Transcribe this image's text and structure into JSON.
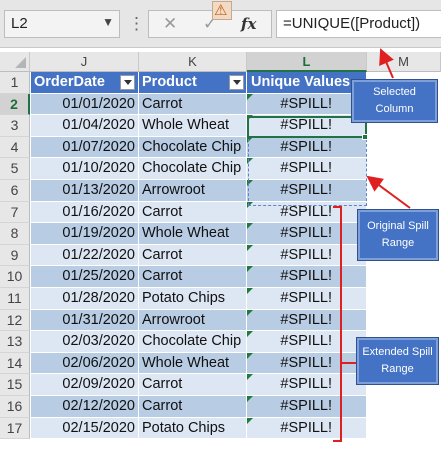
{
  "formula_bar": {
    "name_box": "L2",
    "cancel_icon": "cancel-x-icon",
    "enter_icon": "checkmark-icon",
    "function_icon": "fx",
    "formula": "=UNIQUE([Product])"
  },
  "columns": [
    "J",
    "K",
    "L",
    "M"
  ],
  "selected_column": "L",
  "table_header": {
    "row": "1",
    "order_date": "OrderDate",
    "product": "Product",
    "unique_values": "Unique Values"
  },
  "rows": [
    {
      "row": "2",
      "date": "01/01/2020",
      "product": "Carrot",
      "unique": "#SPILL!"
    },
    {
      "row": "3",
      "date": "01/04/2020",
      "product": "Whole Wheat",
      "unique": "#SPILL!"
    },
    {
      "row": "4",
      "date": "01/07/2020",
      "product": "Chocolate Chip",
      "unique": "#SPILL!"
    },
    {
      "row": "5",
      "date": "01/10/2020",
      "product": "Chocolate Chip",
      "unique": "#SPILL!"
    },
    {
      "row": "6",
      "date": "01/13/2020",
      "product": "Arrowroot",
      "unique": "#SPILL!"
    },
    {
      "row": "7",
      "date": "01/16/2020",
      "product": "Carrot",
      "unique": "#SPILL!"
    },
    {
      "row": "8",
      "date": "01/19/2020",
      "product": "Whole Wheat",
      "unique": "#SPILL!"
    },
    {
      "row": "9",
      "date": "01/22/2020",
      "product": "Carrot",
      "unique": "#SPILL!"
    },
    {
      "row": "10",
      "date": "01/25/2020",
      "product": "Carrot",
      "unique": "#SPILL!"
    },
    {
      "row": "11",
      "date": "01/28/2020",
      "product": "Potato Chips",
      "unique": "#SPILL!"
    },
    {
      "row": "12",
      "date": "01/31/2020",
      "product": "Arrowroot",
      "unique": "#SPILL!"
    },
    {
      "row": "13",
      "date": "02/03/2020",
      "product": "Chocolate Chip",
      "unique": "#SPILL!"
    },
    {
      "row": "14",
      "date": "02/06/2020",
      "product": "Whole Wheat",
      "unique": "#SPILL!"
    },
    {
      "row": "15",
      "date": "02/09/2020",
      "product": "Carrot",
      "unique": "#SPILL!"
    },
    {
      "row": "16",
      "date": "02/12/2020",
      "product": "Carrot",
      "unique": "#SPILL!"
    },
    {
      "row": "17",
      "date": "02/15/2020",
      "product": "Potato Chips",
      "unique": "#SPILL!"
    }
  ],
  "callouts": {
    "selected_column": "Selected Column",
    "original_spill_range": "Original Spill Range",
    "extended_spill_range": "Extended Spill Range"
  },
  "warning_icon": "warning-icon",
  "colors": {
    "header_blue": "#4472C4",
    "band_light": "#DDE6F3",
    "band_dark": "#B8CCE4",
    "excel_green": "#217346",
    "annotation_red": "#E02020"
  }
}
